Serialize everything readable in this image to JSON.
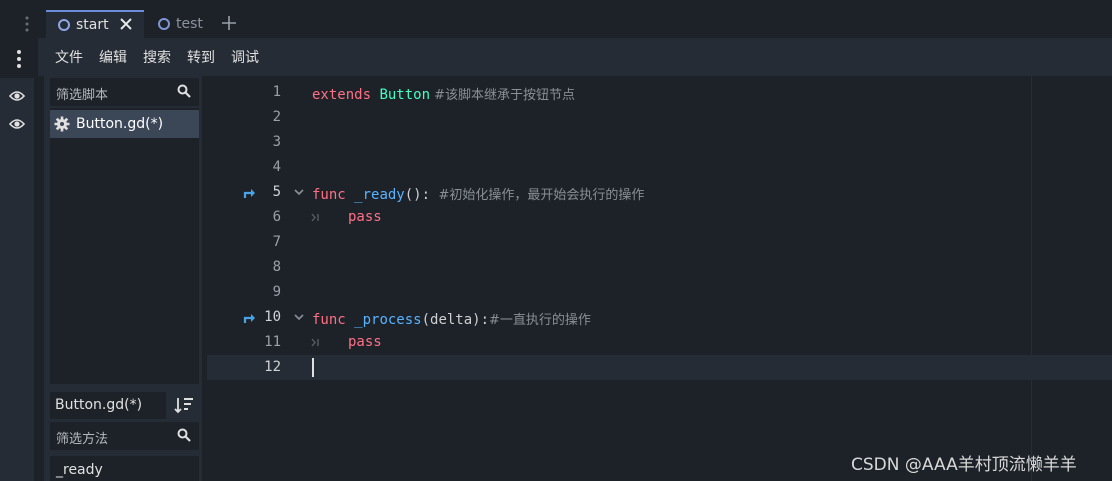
{
  "tabs": [
    {
      "label": "start",
      "active": true
    },
    {
      "label": "test",
      "active": false
    }
  ],
  "menu": [
    "文件",
    "编辑",
    "搜索",
    "转到",
    "调试"
  ],
  "script_panel": {
    "filter_placeholder": "筛选脚本",
    "scripts": [
      {
        "name": "Button.gd(*)",
        "icon": "gear-icon"
      }
    ],
    "current_script": "Button.gd(*)",
    "method_filter_placeholder": "筛选方法",
    "methods": [
      "_ready"
    ]
  },
  "editor": {
    "lines": [
      {
        "num": "1",
        "tokens": [
          {
            "t": "extends",
            "c": "kw"
          },
          {
            "t": " ",
            "c": ""
          },
          {
            "t": "Button",
            "c": "ty"
          },
          {
            "t": " #该脚本继承于按钮节点",
            "c": "cm"
          }
        ]
      },
      {
        "num": "2",
        "tokens": []
      },
      {
        "num": "3",
        "tokens": []
      },
      {
        "num": "4",
        "tokens": []
      },
      {
        "num": "5",
        "marked": true,
        "fold": true,
        "tokens": [
          {
            "t": "func",
            "c": "kw"
          },
          {
            "t": " ",
            "c": ""
          },
          {
            "t": "_ready",
            "c": "fn"
          },
          {
            "t": "(): ",
            "c": ""
          },
          {
            "t": "#初始化操作，最开始会执行的操作",
            "c": "cm"
          }
        ]
      },
      {
        "num": "6",
        "indent": true,
        "tokens": [
          {
            "t": "pass",
            "c": "kw"
          }
        ]
      },
      {
        "num": "7",
        "tokens": []
      },
      {
        "num": "8",
        "tokens": []
      },
      {
        "num": "9",
        "tokens": []
      },
      {
        "num": "10",
        "marked": true,
        "fold": true,
        "tokens": [
          {
            "t": "func",
            "c": "kw"
          },
          {
            "t": " ",
            "c": ""
          },
          {
            "t": "_process",
            "c": "fn"
          },
          {
            "t": "(delta):",
            "c": ""
          },
          {
            "t": "#一直执行的操作",
            "c": "cm"
          }
        ]
      },
      {
        "num": "11",
        "indent": true,
        "tokens": [
          {
            "t": "pass",
            "c": "kw"
          }
        ]
      },
      {
        "num": "12",
        "current": true,
        "tokens": []
      }
    ]
  },
  "watermark": "CSDN @AAA羊村顶流懒羊羊",
  "colors": {
    "keyword": "#ff7085",
    "type": "#42ffc2",
    "function": "#57b3ff",
    "comment": "#8a8f95",
    "accent": "#6b8cd8"
  }
}
